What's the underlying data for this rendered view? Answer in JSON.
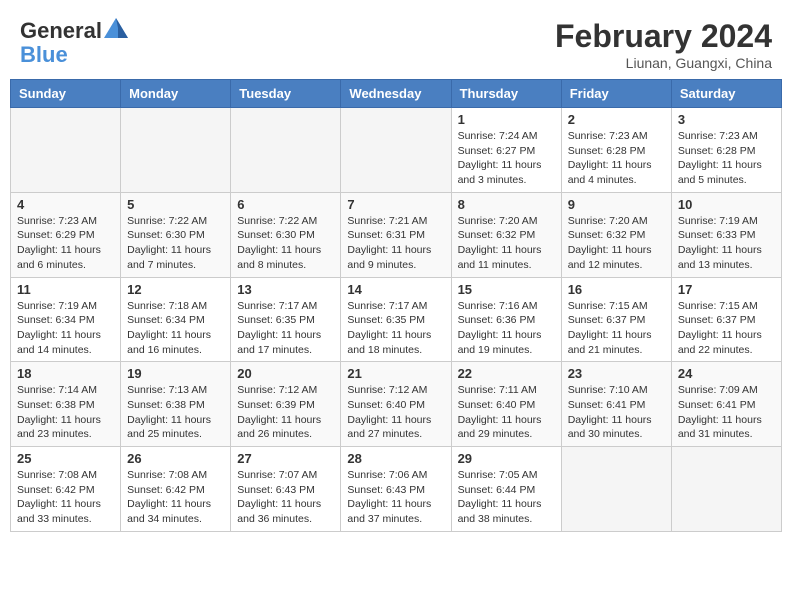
{
  "header": {
    "logo_general": "General",
    "logo_blue": "Blue",
    "month_year": "February 2024",
    "location": "Liunan, Guangxi, China"
  },
  "days_of_week": [
    "Sunday",
    "Monday",
    "Tuesday",
    "Wednesday",
    "Thursday",
    "Friday",
    "Saturday"
  ],
  "weeks": [
    [
      null,
      null,
      null,
      null,
      {
        "day": 1,
        "sunrise": "7:24 AM",
        "sunset": "6:27 PM",
        "daylight": "11 hours and 3 minutes."
      },
      {
        "day": 2,
        "sunrise": "7:23 AM",
        "sunset": "6:28 PM",
        "daylight": "11 hours and 4 minutes."
      },
      {
        "day": 3,
        "sunrise": "7:23 AM",
        "sunset": "6:28 PM",
        "daylight": "11 hours and 5 minutes."
      }
    ],
    [
      {
        "day": 4,
        "sunrise": "7:23 AM",
        "sunset": "6:29 PM",
        "daylight": "11 hours and 6 minutes."
      },
      {
        "day": 5,
        "sunrise": "7:22 AM",
        "sunset": "6:30 PM",
        "daylight": "11 hours and 7 minutes."
      },
      {
        "day": 6,
        "sunrise": "7:22 AM",
        "sunset": "6:30 PM",
        "daylight": "11 hours and 8 minutes."
      },
      {
        "day": 7,
        "sunrise": "7:21 AM",
        "sunset": "6:31 PM",
        "daylight": "11 hours and 9 minutes."
      },
      {
        "day": 8,
        "sunrise": "7:20 AM",
        "sunset": "6:32 PM",
        "daylight": "11 hours and 11 minutes."
      },
      {
        "day": 9,
        "sunrise": "7:20 AM",
        "sunset": "6:32 PM",
        "daylight": "11 hours and 12 minutes."
      },
      {
        "day": 10,
        "sunrise": "7:19 AM",
        "sunset": "6:33 PM",
        "daylight": "11 hours and 13 minutes."
      }
    ],
    [
      {
        "day": 11,
        "sunrise": "7:19 AM",
        "sunset": "6:34 PM",
        "daylight": "11 hours and 14 minutes."
      },
      {
        "day": 12,
        "sunrise": "7:18 AM",
        "sunset": "6:34 PM",
        "daylight": "11 hours and 16 minutes."
      },
      {
        "day": 13,
        "sunrise": "7:17 AM",
        "sunset": "6:35 PM",
        "daylight": "11 hours and 17 minutes."
      },
      {
        "day": 14,
        "sunrise": "7:17 AM",
        "sunset": "6:35 PM",
        "daylight": "11 hours and 18 minutes."
      },
      {
        "day": 15,
        "sunrise": "7:16 AM",
        "sunset": "6:36 PM",
        "daylight": "11 hours and 19 minutes."
      },
      {
        "day": 16,
        "sunrise": "7:15 AM",
        "sunset": "6:37 PM",
        "daylight": "11 hours and 21 minutes."
      },
      {
        "day": 17,
        "sunrise": "7:15 AM",
        "sunset": "6:37 PM",
        "daylight": "11 hours and 22 minutes."
      }
    ],
    [
      {
        "day": 18,
        "sunrise": "7:14 AM",
        "sunset": "6:38 PM",
        "daylight": "11 hours and 23 minutes."
      },
      {
        "day": 19,
        "sunrise": "7:13 AM",
        "sunset": "6:38 PM",
        "daylight": "11 hours and 25 minutes."
      },
      {
        "day": 20,
        "sunrise": "7:12 AM",
        "sunset": "6:39 PM",
        "daylight": "11 hours and 26 minutes."
      },
      {
        "day": 21,
        "sunrise": "7:12 AM",
        "sunset": "6:40 PM",
        "daylight": "11 hours and 27 minutes."
      },
      {
        "day": 22,
        "sunrise": "7:11 AM",
        "sunset": "6:40 PM",
        "daylight": "11 hours and 29 minutes."
      },
      {
        "day": 23,
        "sunrise": "7:10 AM",
        "sunset": "6:41 PM",
        "daylight": "11 hours and 30 minutes."
      },
      {
        "day": 24,
        "sunrise": "7:09 AM",
        "sunset": "6:41 PM",
        "daylight": "11 hours and 31 minutes."
      }
    ],
    [
      {
        "day": 25,
        "sunrise": "7:08 AM",
        "sunset": "6:42 PM",
        "daylight": "11 hours and 33 minutes."
      },
      {
        "day": 26,
        "sunrise": "7:08 AM",
        "sunset": "6:42 PM",
        "daylight": "11 hours and 34 minutes."
      },
      {
        "day": 27,
        "sunrise": "7:07 AM",
        "sunset": "6:43 PM",
        "daylight": "11 hours and 36 minutes."
      },
      {
        "day": 28,
        "sunrise": "7:06 AM",
        "sunset": "6:43 PM",
        "daylight": "11 hours and 37 minutes."
      },
      {
        "day": 29,
        "sunrise": "7:05 AM",
        "sunset": "6:44 PM",
        "daylight": "11 hours and 38 minutes."
      },
      null,
      null
    ]
  ]
}
